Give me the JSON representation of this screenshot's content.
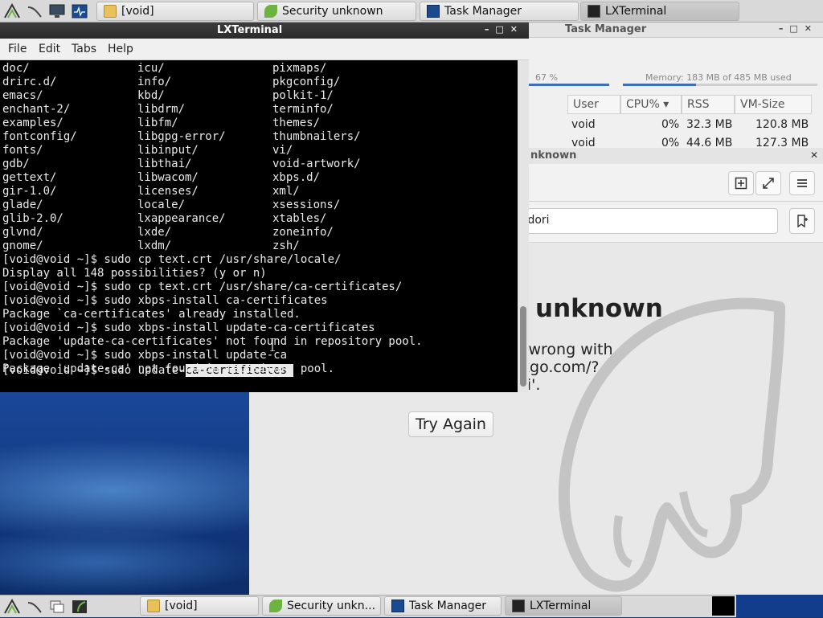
{
  "panel_top": {
    "tasks": [
      {
        "label": "[void]",
        "icon": "folder-icon"
      },
      {
        "label": "Security unknown",
        "icon": "midori-icon"
      },
      {
        "label": "Task Manager",
        "icon": "task-manager-icon"
      },
      {
        "label": "LXTerminal",
        "icon": "terminal-icon"
      }
    ]
  },
  "panel_bottom": {
    "tasks": [
      {
        "label": "[void]",
        "icon": "folder-icon"
      },
      {
        "label": "Security unkn...",
        "icon": "midori-icon"
      },
      {
        "label": "Task Manager",
        "icon": "task-manager-icon"
      },
      {
        "label": "LXTerminal",
        "icon": "terminal-icon"
      }
    ]
  },
  "taskmanager": {
    "title": "Task Manager",
    "cpu_label": "67 %",
    "memory_label": "Memory: 183 MB of 485 MB used",
    "memory_fraction": 0.377,
    "columns": [
      "User",
      "CPU%",
      "RSS",
      "VM-Size"
    ],
    "rows": [
      {
        "user": "void",
        "cpu": "0%",
        "rss": "32.3 MB",
        "vm": "120.8 MB"
      },
      {
        "user": "void",
        "cpu": "0%",
        "rss": "44.6 MB",
        "vm": "127.3 MB"
      }
    ]
  },
  "browser": {
    "title": "nknown",
    "url_fragment": "dg&t=midori",
    "error_title": "unknown",
    "error_lines": [
      "t wrong with",
      "kgo.com/?",
      "ri'."
    ],
    "try_again_label": "Try Again"
  },
  "terminal": {
    "title": "LXTerminal",
    "menu": [
      "File",
      "Edit",
      "Tabs",
      "Help"
    ],
    "listing": [
      [
        "doc/",
        "icu/",
        "pixmaps/"
      ],
      [
        "drirc.d/",
        "info/",
        "pkgconfig/"
      ],
      [
        "emacs/",
        "kbd/",
        "polkit-1/"
      ],
      [
        "enchant-2/",
        "libdrm/",
        "terminfo/"
      ],
      [
        "examples/",
        "libfm/",
        "themes/"
      ],
      [
        "fontconfig/",
        "libgpg-error/",
        "thumbnailers/"
      ],
      [
        "fonts/",
        "libinput/",
        "vi/"
      ],
      [
        "gdb/",
        "libthai/",
        "void-artwork/"
      ],
      [
        "gettext/",
        "libwacom/",
        "xbps.d/"
      ],
      [
        "gir-1.0/",
        "licenses/",
        "xml/"
      ],
      [
        "glade/",
        "locale/",
        "xsessions/"
      ],
      [
        "glib-2.0/",
        "lxappearance/",
        "xtables/"
      ],
      [
        "glvnd/",
        "lxde/",
        "zoneinfo/"
      ],
      [
        "gnome/",
        "lxdm/",
        "zsh/"
      ]
    ],
    "lines": [
      "[void@void ~]$ sudo cp text.crt /usr/share/locale/",
      "Display all 148 possibilities? (y or n)",
      "[void@void ~]$ sudo cp text.crt /usr/share/ca-certificates/",
      "[void@void ~]$ sudo xbps-install ca-certificates",
      "Package `ca-certificates' already installed.",
      "[void@void ~]$ sudo xbps-install update-ca-certificates",
      "Package 'update-ca-certificates' not found in repository pool.",
      "[void@void ~]$ sudo xbps-install update-ca",
      "Package 'update-ca' not found in repository pool."
    ],
    "prompt_prefix": "[void@void ~]$ sudo update-",
    "prompt_selected": "ca-certificates "
  }
}
